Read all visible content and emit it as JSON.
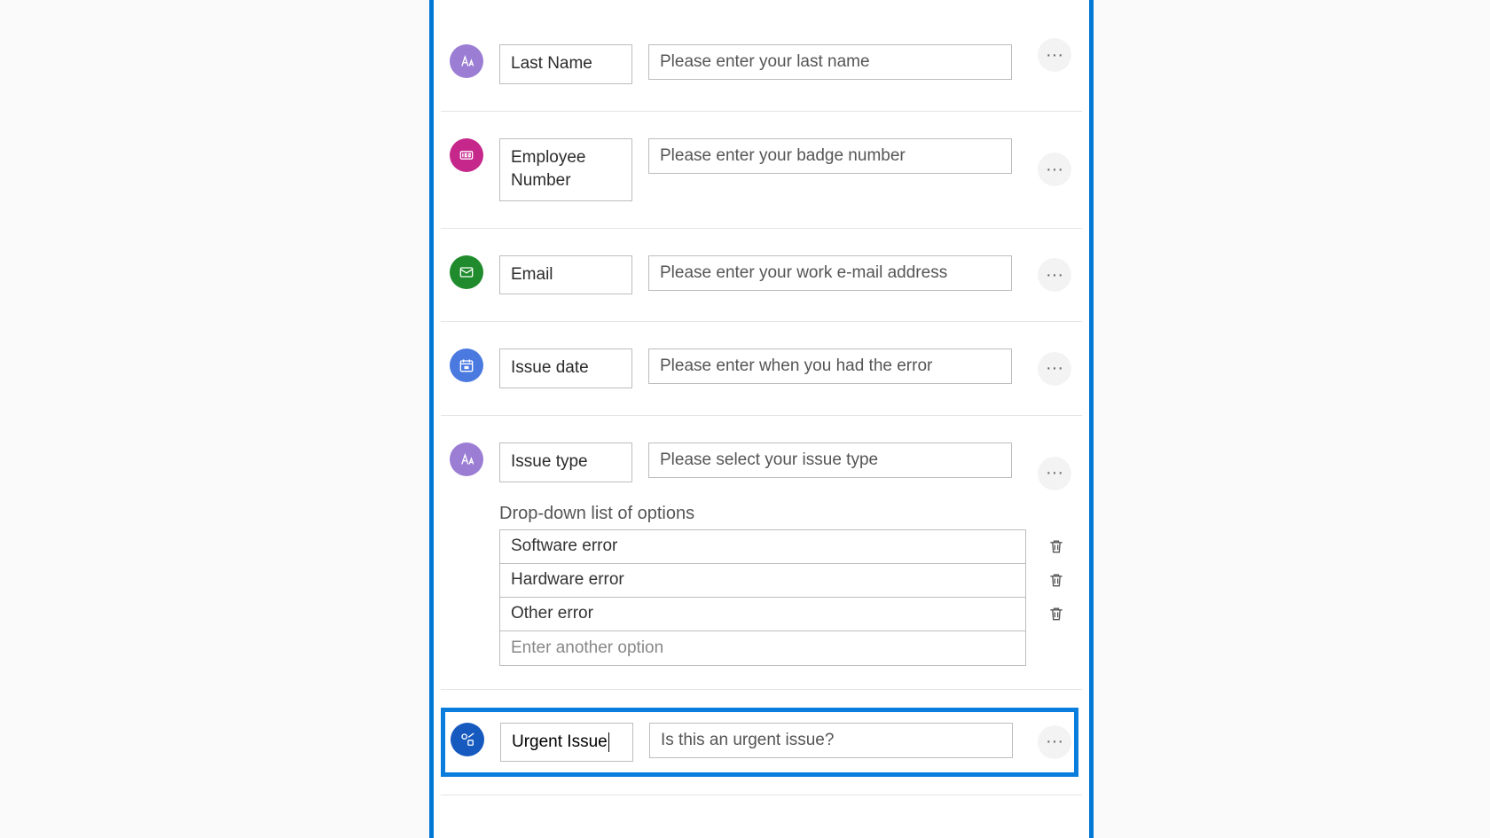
{
  "questions": {
    "last_name": {
      "label": "Last Name",
      "message": "Please enter your last name"
    },
    "employee_number": {
      "label": "Employee Number",
      "message": "Please enter your badge number"
    },
    "email": {
      "label": "Email",
      "message": "Please enter your work e-mail address"
    },
    "issue_date": {
      "label": "Issue date",
      "message": "Please enter when you had the error"
    },
    "issue_type": {
      "label": "Issue type",
      "message": "Please select your issue type",
      "dropdown_heading": "Drop-down list of options",
      "options": {
        "0": "Software error",
        "1": "Hardware error",
        "2": "Other error"
      },
      "add_option_placeholder": "Enter another option"
    },
    "urgent_issue": {
      "label": "Urgent Issue",
      "message": "Is this an urgent issue?"
    }
  },
  "ellipsis_glyph": "···"
}
